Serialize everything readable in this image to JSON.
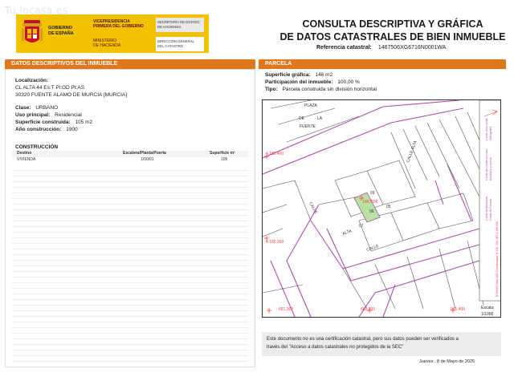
{
  "watermark": "Tu locasa.es",
  "header": {
    "gov_line1": "GOBIERNO",
    "gov_line2": "DE ESPAÑA",
    "vice_line1": "VICEPRESIDENCIA",
    "vice_line2": "PRIMERA DEL GOBIERNO",
    "min_line1": "MINISTERIO",
    "min_line2": "DE HACIENDA",
    "sec_line1": "SECRETARÍA DE ESTADO",
    "sec_line2": "DE HACIENDA",
    "dir_line1": "DIRECCIÓN GENERAL",
    "dir_line2": "DEL CATASTRO",
    "title_line1": "CONSULTA DESCRIPTIVA Y GRÁFICA",
    "title_line2": "DE DATOS CATASTRALES DE BIEN INMUEBLE",
    "ref_label": "Referencia catastral:",
    "ref_value": "1467506XG6716N0001WA"
  },
  "left": {
    "bar": "DATOS DESCRIPTIVOS DEL INMUEBLE",
    "loc_label": "Localización:",
    "loc_line1": "CL ALTA 44 Es:T Pl:OD Pt:AS",
    "loc_line2": "30320 FUENTE ALAMO DE MURCIA [MURCIA]",
    "clase_label": "Clase:",
    "clase_value": "URBANO",
    "uso_label": "Uso principal:",
    "uso_value": "Residencial",
    "sup_label": "Superficie construida:",
    "sup_value": "105 m2",
    "anio_label": "Año construcción:",
    "anio_value": "1900",
    "cons_title": "CONSTRUCCIÓN",
    "cols": [
      "Destino",
      "Escalera/Planta/Puerta",
      "Superficie m²"
    ],
    "rows": [
      [
        "VIVIENDA",
        "1/00/01",
        "105"
      ]
    ]
  },
  "right": {
    "bar": "PARCELA",
    "sg_label": "Superficie gráfica:",
    "sg_value": "146 m2",
    "pi_label": "Participación del inmueble:",
    "pi_value": "100,00 %",
    "tipo_label": "Tipo:",
    "tipo_value": "Parcela construida sin división horizontal",
    "map_labels": {
      "plaza": "PLAZA",
      "de": "DE",
      "la": "LA",
      "fuente": "FUENTE",
      "calle_alta": "CALLE ALTA",
      "calle": "CALLE",
      "calle_alta2": "ALTA",
      "n09": "09",
      "n06": "06",
      "n05": "05",
      "n07": "07",
      "parcel": "1467506",
      "y1": "4.185.400",
      "y2": "4.185.300",
      "x1": "661,300",
      "x2": "661,350",
      "x3": "661,400",
      "escala_label": "Escala:",
      "escala_value": "1/1000",
      "side1": "Límite de Manzana",
      "side2": "Límite de Parcela",
      "side3": "Límite de Construcciones",
      "side4": "Mobiliario y aceras",
      "side5": "Límite zona verde",
      "side6": "Hidrografía",
      "side_coords": "ETRS89 Huso 30N Coordenadas U.T.M.: 661,355 4,185,350"
    },
    "disclaimer_line1": "Este documento no es una certificación catastral, pero sus datos pueden ser verificados a",
    "disclaimer_line2": "través del \"Acceso a datos catastrales no protegidos de la SEC\"",
    "date": "Jueves , 8 de Mayo de 2025"
  },
  "colors": {
    "accent": "#e2761b",
    "gov_yellow": "#f2c200",
    "parcel_lines": "#b04fb0",
    "parcel_fill": "#b6e3a3",
    "highlight": "#ff3b3b"
  }
}
